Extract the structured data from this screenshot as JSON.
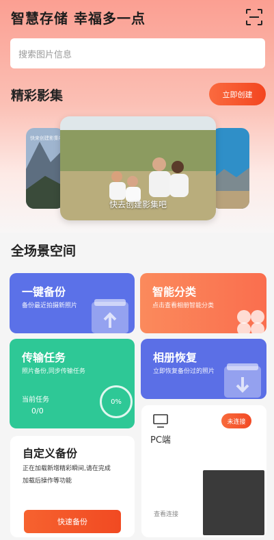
{
  "header": {
    "title": "智慧存储 幸福多一点",
    "scan_icon": "scan-icon"
  },
  "search": {
    "placeholder": "搜索图片信息"
  },
  "album": {
    "title": "精彩影集",
    "create_label": "立即创建",
    "main_caption": "快去创建影集吧",
    "side_caption": "快来创建影集吧"
  },
  "space": {
    "title": "全场景空间",
    "cards": {
      "backup": {
        "title": "一键备份",
        "subtitle": "备份最近拍摄新照片"
      },
      "classify": {
        "title": "智能分类",
        "subtitle": "点击查看相册智能分类"
      },
      "transfer": {
        "title": "传输任务",
        "subtitle": "照片备份,同步传输任务",
        "current_label": "当前任务",
        "current_value": "0/0",
        "progress_text": "0%",
        "progress": 0
      },
      "restore": {
        "title": "相册恢复",
        "subtitle": "立即恢复备份过的照片"
      },
      "custom": {
        "title": "自定义备份",
        "desc_line1": "正在加载新增精彩瞬间,请在完成",
        "desc_line2": "加载后操作等功能",
        "button": "快速备份"
      },
      "pc": {
        "title": "PC端",
        "badge": "未连接",
        "link": "查看连接"
      }
    }
  },
  "colors": {
    "accent": "#f4511e",
    "backup_card": "#5b71e8",
    "classify_card": "#fb7a56",
    "transfer_card": "#2ec896",
    "restore_card": "#5b6fe6"
  }
}
